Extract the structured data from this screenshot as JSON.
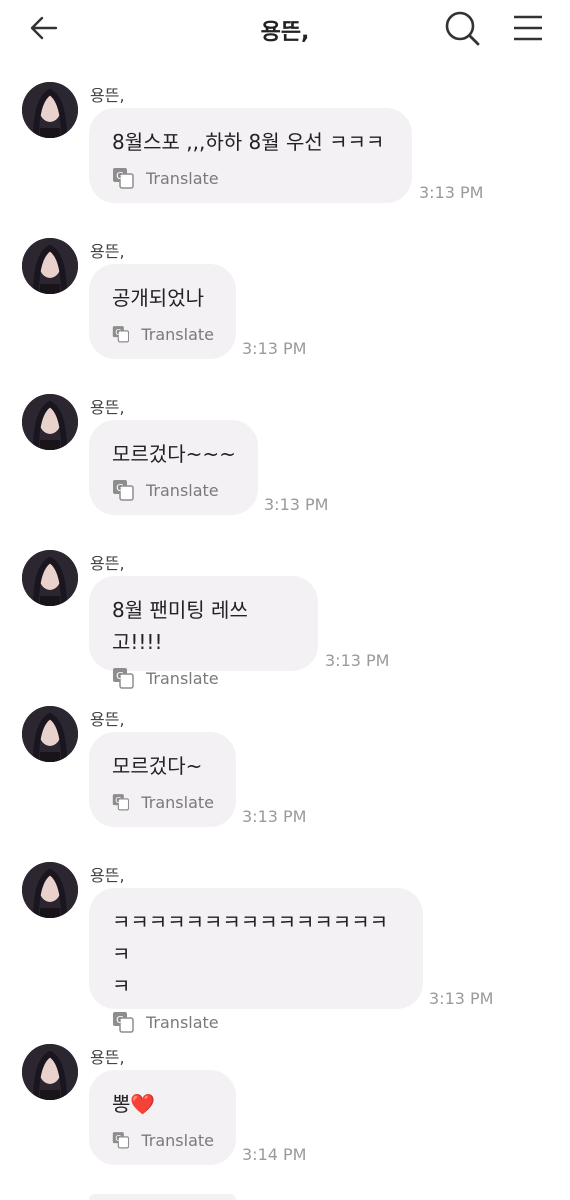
{
  "header": {
    "title": "용뜬,",
    "back_icon": "arrow-left-icon",
    "search_icon": "search-icon",
    "menu_icon": "hamburger-menu-icon"
  },
  "messages": [
    {
      "sender": "용뜬,",
      "text": "8월스포 ,,,하하 8월 우선 ㅋㅋㅋ",
      "translate": "Translate",
      "time": "3:13 PM"
    },
    {
      "sender": "용뜬,",
      "text": "공개되었나",
      "translate": "Translate",
      "time": "3:13 PM"
    },
    {
      "sender": "용뜬,",
      "text": "모르겄다~~~",
      "translate": "Translate",
      "time": "3:13 PM"
    },
    {
      "sender": "용뜬,",
      "text": "8월 팬미팅 레쓰고!!!!",
      "translate": "Translate",
      "time": "3:13 PM"
    },
    {
      "sender": "용뜬,",
      "text": "모르겄다~",
      "translate": "Translate",
      "time": "3:13 PM"
    },
    {
      "sender": "용뜬,",
      "text": "ㅋㅋㅋㅋㅋㅋㅋㅋㅋㅋㅋㅋㅋㅋㅋㅋ\nㅋ",
      "translate": "Translate",
      "time": "3:13 PM"
    },
    {
      "sender": "용뜬,",
      "text": "뽕❤️",
      "translate": "Translate",
      "time": "3:14 PM"
    }
  ]
}
